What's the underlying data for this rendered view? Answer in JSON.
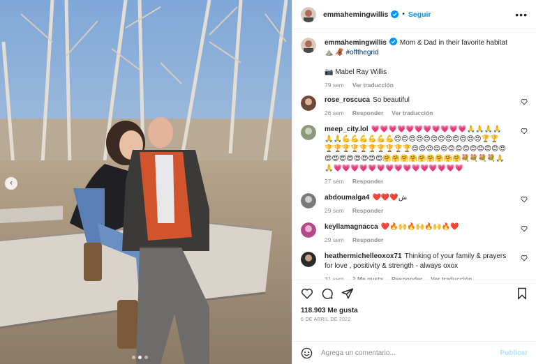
{
  "post": {
    "author": "emmahemingwillis",
    "follow_label": "Seguir",
    "separator": "•",
    "more_label": "•••",
    "caption": {
      "text": "Mom & Dad in their favorite habitat ⛰️ 🦧",
      "hashtag": "#offthegrid",
      "credit": "📷 Mabel Ray Willis",
      "time": "79 sem",
      "translate": "Ver traducción"
    },
    "comments": [
      {
        "user": "rose_roscuca",
        "text": "So beautiful",
        "time": "26 sem",
        "reply": "Responder",
        "translate": "Ver traducción",
        "avatar_color": "#6b4a3a"
      },
      {
        "user": "meep_city.lol",
        "text": "💗💗💗💗💗💗💗💗💗💗💗🙏🙏🙏🙏🙏🙏💪💪💪💪💪💪😍😍😍😍😍😍😍😍😍😍😍😍🏆🏆🏆🏆🏆🏆🏆🏆🏆🏆🏆🏆😌😌😌😌😌😊😊😊😊😊😊😊😍😍😍😍😍😍😍😍😍🤗🤗🤗🤗🤗🤗🤗🤗🤗💐💐💐💐🙏🙏💗💗💗💗💗💗💗💗💗💗💗💗💗💗💗",
        "time": "27 sem",
        "reply": "Responder",
        "avatar_color": "#8a9a7a"
      },
      {
        "user": "abdoumalga4",
        "text": "❤️❤️❤️ش",
        "time": "29 sem",
        "reply": "Responder",
        "avatar_color": "#7a7a7a"
      },
      {
        "user": "keyllamagnacca",
        "text": "❤️🔥🙌🔥🙌🔥🙌🔥❤️",
        "time": "29 sem",
        "reply": "Responder",
        "avatar_color": "#b04a8a"
      },
      {
        "user": "heathermichelleoxox71",
        "text": "Thinking of your family & prayers for love , positivity & strength - always oxox",
        "time": "31 sem",
        "likes": "2 Me gusta",
        "reply": "Responder",
        "translate": "Ver traducción",
        "avatar_color": "#2a2a2a"
      }
    ],
    "likes_count": "118.903 Me gusta",
    "date": "6 DE ABRIL DE 2022",
    "comment_placeholder": "Agrega un comentario...",
    "publish_label": "Publicar",
    "nav_prev": "‹"
  },
  "colors": {
    "accent": "#0095f6",
    "muted": "#8e8e8e",
    "publish_disabled": "#b2dffc"
  }
}
